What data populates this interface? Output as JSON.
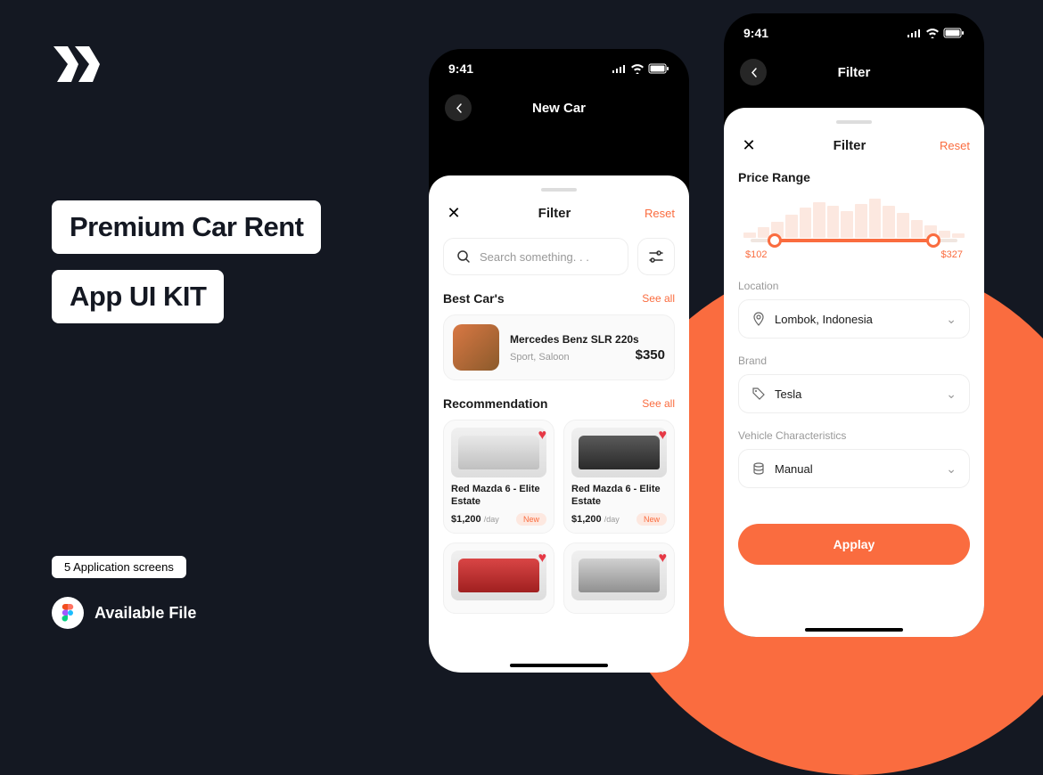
{
  "marketing": {
    "title1": "Premium Car Rent",
    "title2": "App UI KIT",
    "badge": "5 Application screens",
    "available": "Available File"
  },
  "common": {
    "time": "9:41",
    "filter_title": "Filter",
    "reset": "Reset",
    "see_all": "See all"
  },
  "phone1": {
    "nav_title": "New Car",
    "search_placeholder": "Search something. . .",
    "best_title": "Best Car's",
    "best_car": {
      "name": "Mercedes Benz SLR 220s",
      "sub": "Sport, Saloon",
      "price": "$350"
    },
    "rec_title": "Recommendation",
    "rec": [
      {
        "name": "Red Mazda 6 - Elite Estate",
        "price": "$1,200",
        "day": "/day",
        "badge": "New"
      },
      {
        "name": "Red Mazda 6 - Elite Estate",
        "price": "$1,200",
        "day": "/day",
        "badge": "New"
      }
    ]
  },
  "phone2": {
    "nav_title": "Filter",
    "price_title": "Price Range",
    "price_min": "$102",
    "price_max": "$327",
    "location_label": "Location",
    "location_value": "Lombok, Indonesia",
    "brand_label": "Brand",
    "brand_value": "Tesla",
    "vehicle_label": "Vehicle Characteristics",
    "vehicle_value": "Manual",
    "apply": "Applay"
  },
  "histogram": [
    6,
    12,
    18,
    26,
    34,
    40,
    36,
    30,
    38,
    44,
    36,
    28,
    20,
    14,
    8,
    5
  ]
}
